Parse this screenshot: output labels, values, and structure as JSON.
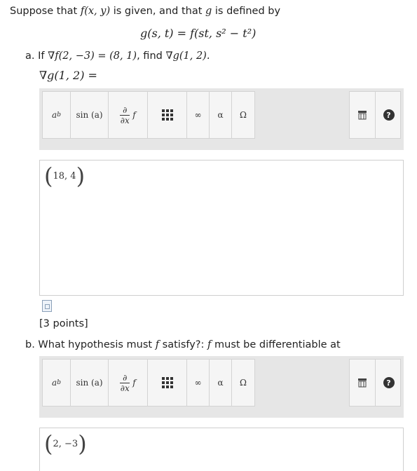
{
  "problem": {
    "intro_prefix": "Suppose that ",
    "intro_f": "f(x, y)",
    "intro_mid": " is given, and that ",
    "intro_g": "g",
    "intro_suffix": " is defined by",
    "formula": "g(s, t) = f(st, s² − t²)"
  },
  "part_a": {
    "prefix": "a. If ",
    "given": "∇f(2, −3) = (8, 1)",
    "mid": ", find ",
    "target": "∇g(1, 2).",
    "answer_label": "∇g(1, 2) ="
  },
  "toolbar": {
    "power_label": "a",
    "power_sup": "b",
    "sin_label": "sin (a)",
    "deriv_top": "∂",
    "deriv_bottom": "∂x",
    "deriv_f": "f",
    "infinity": "∞",
    "alpha": "α",
    "omega": "Ω",
    "help": "?"
  },
  "answer_a": {
    "value": "18, 4"
  },
  "points_label": "[3 points]",
  "part_b": {
    "prefix": "b. What hypothesis must ",
    "f1": "f",
    "mid": " satisfy?: ",
    "f2": "f",
    "suffix": " must be differentiable at"
  },
  "answer_b": {
    "value": "2, −3"
  }
}
